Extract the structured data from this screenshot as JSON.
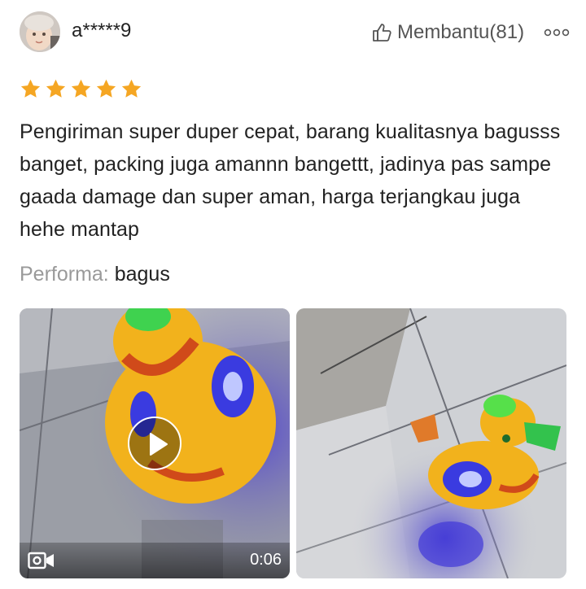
{
  "review": {
    "username": "a*****9",
    "helpful_label": "Membantu(81)",
    "rating": 5,
    "rating_max": 5,
    "text": "Pengiriman super duper cepat, barang kualitasnya bagusss banget, packing juga amannn bangettt, jadinya pas sampe gaada damage dan super aman, harga terjangkau juga hehe mantap",
    "performance_label": "Performa:",
    "performance_value": "bagus",
    "media": [
      {
        "type": "video",
        "duration": "0:06"
      },
      {
        "type": "image"
      }
    ]
  },
  "colors": {
    "star": "#f5a623",
    "text": "#222222",
    "muted": "#9a9a9a"
  },
  "icons": {
    "helpful": "thumbs-up-icon",
    "more": "more-dots-icon",
    "play": "play-icon",
    "video": "video-camera-icon"
  }
}
